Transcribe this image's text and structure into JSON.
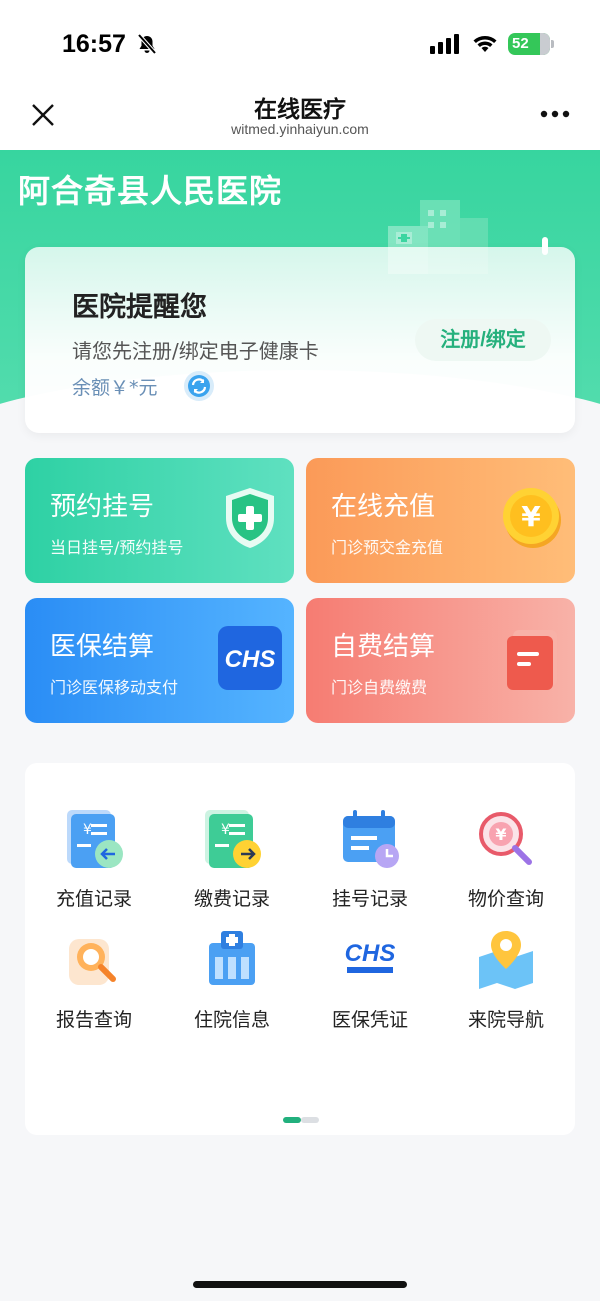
{
  "status_bar": {
    "time": "16:57",
    "battery": "52"
  },
  "nav": {
    "title": "在线医疗",
    "subtitle": "witmed.yinhaiyun.com"
  },
  "hero": {
    "hospital_name": "阿合奇县人民医院"
  },
  "reminder": {
    "title": "医院提醒您",
    "description": "请您先注册/绑定电子健康卡",
    "balance": "余额￥*元",
    "register_label": "注册/绑定"
  },
  "quick_actions": [
    {
      "title": "预约挂号",
      "subtitle": "当日挂号/预约挂号",
      "icon": "shield-plus-icon"
    },
    {
      "title": "在线充值",
      "subtitle": "门诊预交金充值",
      "icon": "yuan-coin-icon"
    },
    {
      "title": "医保结算",
      "subtitle": "门诊医保移动支付",
      "icon": "chs-icon"
    },
    {
      "title": "自费结算",
      "subtitle": "门诊自费缴费",
      "icon": "bill-icon"
    }
  ],
  "services": [
    {
      "label": "充值记录",
      "icon": "recharge-record-icon"
    },
    {
      "label": "缴费记录",
      "icon": "payment-record-icon"
    },
    {
      "label": "挂号记录",
      "icon": "registration-record-icon"
    },
    {
      "label": "物价查询",
      "icon": "price-query-icon"
    },
    {
      "label": "报告查询",
      "icon": "report-query-icon"
    },
    {
      "label": "住院信息",
      "icon": "inpatient-info-icon"
    },
    {
      "label": "医保凭证",
      "icon": "insurance-voucher-icon"
    },
    {
      "label": "来院导航",
      "icon": "navigation-icon"
    }
  ],
  "colors": {
    "brand_green": "#37d59f",
    "accent_text": "#25b07c"
  }
}
